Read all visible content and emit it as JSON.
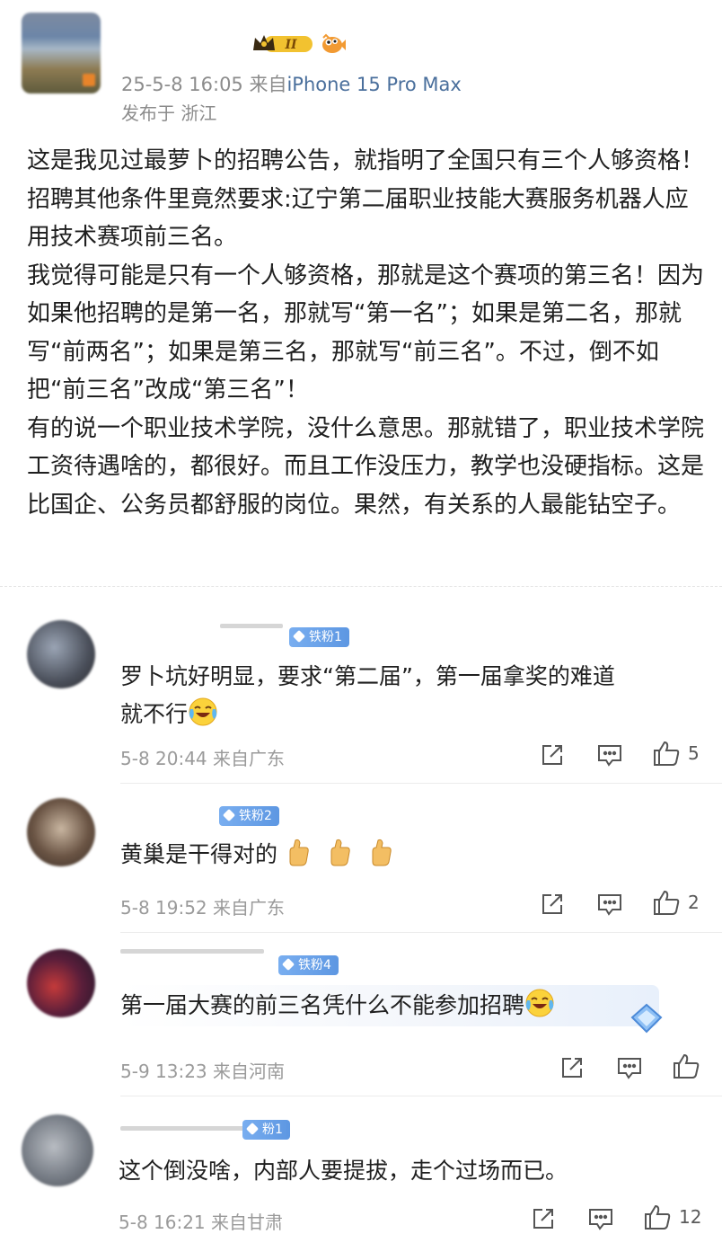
{
  "post": {
    "meta_time_prefix": "25-5-8 16:05  来自",
    "device": "iPhone 15 Pro Max",
    "location": "发布于 浙江",
    "paragraphs": [
      "这是我见过最萝卜的招聘公告，就指明了全国只有三个人够资格！招聘其他条件里竟然要求:辽宁第二届职业技能大赛服务机器人应用技术赛项前三名。",
      "我觉得可能是只有一个人够资格，那就是这个赛项的第三名！因为如果他招聘的是第一名，那就写“第一名”；如果是第二名，那就写“前两名”；如果是第三名，那就写“前三名”。不过，倒不如把“前三名”改成“第三名”！",
      "有的说一个职业技术学院，没什么意思。那就错了，职业技术学院工资待遇啥的，都很好。而且工作没压力，教学也没硬指标。这是比国企、公务员都舒服的岗位。果然，有关系的人最能钻空子。"
    ],
    "badge_icon": "crown-level-badge-icon",
    "badge_level": "II",
    "fish_icon": "fish-badge-icon"
  },
  "comments": [
    {
      "fan_badge": "铁粉1",
      "text_line1": "罗卜坑好明显，要求“第二届”，第一届拿奖的难道",
      "text_line2": "就不行",
      "emoji": "laughing-tears-emoji",
      "meta": "5-8 20:44 来自广东",
      "like_count": "5"
    },
    {
      "fan_badge": "铁粉2",
      "text_line1": "黄巢是干得对的",
      "emoji": "thumbs-up-emoji",
      "meta": "5-8 19:52 来自广东",
      "like_count": "2"
    },
    {
      "fan_badge": "铁粉4",
      "text_line1": "第一届大赛的前三名凭什么不能参加招聘",
      "emoji": "laughing-tears-emoji",
      "meta": "5-9 13:23 来自河南",
      "like_count": ""
    },
    {
      "fan_badge": "粉1",
      "text_line1": "这个倒没啥，内部人要提拔，走个过场而已。",
      "meta": "5-8 16:21 来自甘肃",
      "like_count": "12"
    }
  ],
  "colors": {
    "link_blue": "#4a6f9c",
    "meta_gray": "#9a9a9a",
    "fan_badge_blue": "#5d97e2"
  }
}
